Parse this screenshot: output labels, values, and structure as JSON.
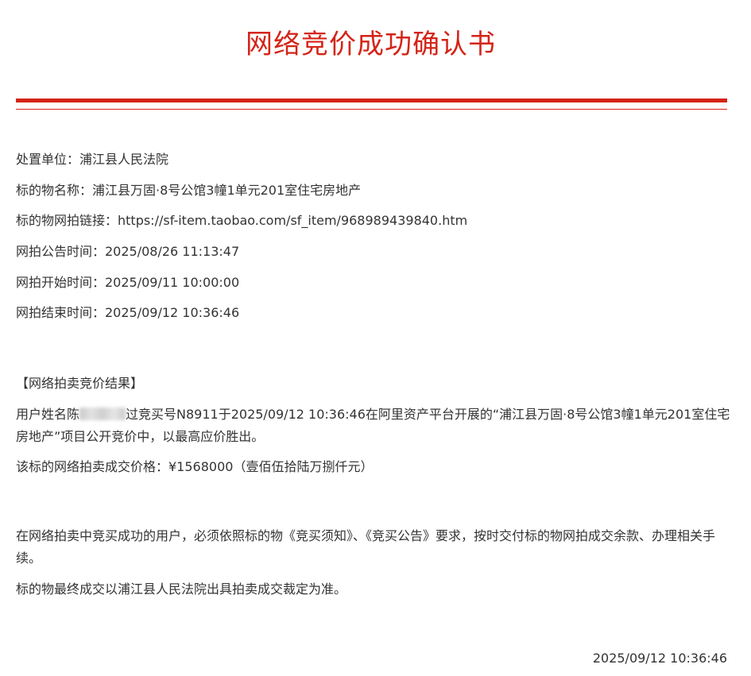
{
  "title": "网络竞价成功确认书",
  "info": {
    "unit": "处置单位：浦江县人民法院",
    "item_name": "标的物名称：浦江县万固·8号公馆3幢1单元201室住宅房地产",
    "link": "标的物网拍链接：https://sf-item.taobao.com/sf_item/968989439840.htm",
    "announce_time": "网拍公告时间：2025/08/26 11:13:47",
    "start_time": "网拍开始时间：2025/09/11 10:00:00",
    "end_time": "网拍结束时间：2025/09/12 10:36:46"
  },
  "result": {
    "heading": "【网络拍卖竞价结果】",
    "user_prefix": "用户姓名陈",
    "user_suffix": "过竞买号N8911于2025/09/12 10:36:46在阿里资产平台开展的“浦江县万固·8号公馆3幢1单元201室住宅房地产”项目公开竞价中，以最高应价胜出。",
    "price": "该标的网络拍卖成交价格：¥1568000（壹佰伍拾陆万捌仟元）"
  },
  "notice": {
    "requirement": "在网络拍卖中竞买成功的用户，必须依照标的物《竞买须知》、《竞买公告》要求，按时交付标的物网拍成交余款、办理相关手续。",
    "final": "标的物最终成交以浦江县人民法院出具拍卖成交裁定为准。"
  },
  "footer_date": "2025/09/12 10:36:46"
}
